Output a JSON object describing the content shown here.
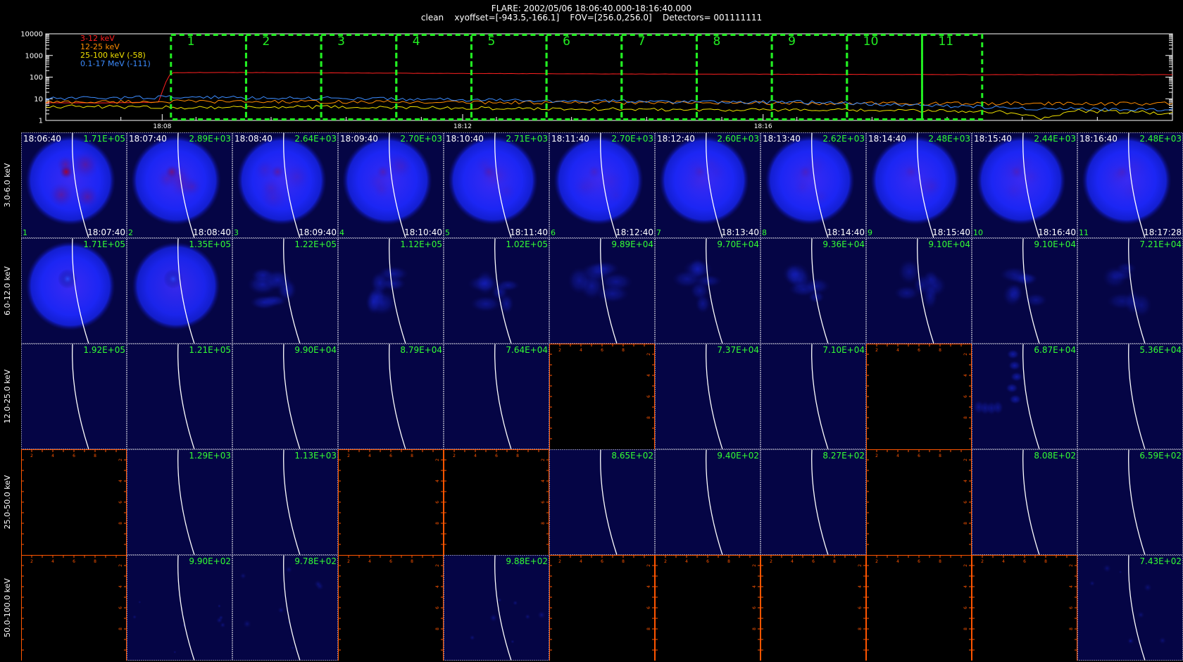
{
  "header": {
    "title": "FLARE: 2002/05/06 18:06:40.000-18:16:40.000",
    "info": "clean    xyoffset=[-943.5,-166.1]    FOV=[256.0,256.0]    Detectors= 001111111"
  },
  "colors": {
    "background": "#000000",
    "band_3_12": "#ff2020",
    "band_12_25": "#ff8c00",
    "band_25_100": "#f0e000",
    "band_01_17": "#3c8cff",
    "interval_box": "#22ee22",
    "empty_axis": "#ff5500",
    "image_bg": "#050545",
    "limb": "#ffffff",
    "panel_label": "#33ff33"
  },
  "chart_data": [
    {
      "type": "line",
      "name": "lightcurve",
      "y_scale": "log",
      "ylim": [
        1,
        10000
      ],
      "y_ticks": [
        "10000",
        "1000",
        "100",
        "10",
        "1"
      ],
      "time_range_sec": [
        0,
        900
      ],
      "x_tick_labels": [
        {
          "label": "18:08",
          "t": 93
        },
        {
          "label": "18:12",
          "t": 333
        },
        {
          "label": "18:16",
          "t": 573
        }
      ],
      "series": [
        {
          "name": "3-12 keV",
          "color": "#ff2020",
          "points": [
            [
              0,
              6.5
            ],
            [
              50,
              6.5
            ],
            [
              90,
              7
            ],
            [
              96,
              60
            ],
            [
              100,
              160
            ],
            [
              140,
              165
            ],
            [
              190,
              160
            ],
            [
              300,
              150
            ],
            [
              450,
              140
            ],
            [
              600,
              135
            ],
            [
              750,
              130
            ],
            [
              900,
              130
            ]
          ]
        },
        {
          "name": "12-25 keV",
          "color": "#ff8c00",
          "points": [
            [
              0,
              7
            ],
            [
              100,
              7.5
            ],
            [
              300,
              7
            ],
            [
              500,
              6.5
            ],
            [
              700,
              6
            ],
            [
              900,
              6
            ]
          ]
        },
        {
          "name": "25-100 keV (-58)",
          "color": "#f0e000",
          "points": [
            [
              0,
              4.5
            ],
            [
              100,
              4
            ],
            [
              200,
              4.2
            ],
            [
              300,
              3.8
            ],
            [
              400,
              3.5
            ],
            [
              500,
              3.2
            ],
            [
              600,
              3
            ],
            [
              700,
              2.8
            ],
            [
              760,
              2.6
            ],
            [
              800,
              1.2
            ],
            [
              820,
              2.8
            ],
            [
              900,
              2.2
            ]
          ]
        },
        {
          "name": "0.1-17 MeV (-111)",
          "color": "#3c8cff",
          "points": [
            [
              0,
              10
            ],
            [
              100,
              12
            ],
            [
              200,
              11
            ],
            [
              300,
              9.5
            ],
            [
              400,
              8
            ],
            [
              500,
              7.5
            ],
            [
              600,
              7
            ],
            [
              700,
              5
            ],
            [
              800,
              3.5
            ],
            [
              900,
              3
            ]
          ]
        }
      ],
      "intervals": [
        {
          "label": "1",
          "t0": 100,
          "t1": 160
        },
        {
          "label": "2",
          "t0": 160,
          "t1": 220
        },
        {
          "label": "3",
          "t0": 220,
          "t1": 280
        },
        {
          "label": "4",
          "t0": 280,
          "t1": 340
        },
        {
          "label": "5",
          "t0": 340,
          "t1": 400
        },
        {
          "label": "6",
          "t0": 400,
          "t1": 460
        },
        {
          "label": "7",
          "t0": 460,
          "t1": 520
        },
        {
          "label": "8",
          "t0": 520,
          "t1": 580
        },
        {
          "label": "9",
          "t0": 580,
          "t1": 640
        },
        {
          "label": "10",
          "t0": 640,
          "t1": 700
        },
        {
          "label": "11",
          "t0": 700,
          "t1": 748
        }
      ]
    },
    {
      "type": "heatmap",
      "name": "image-mosaic",
      "start_times": [
        "18:06:40",
        "18:07:40",
        "18:08:40",
        "18:09:40",
        "18:10:40",
        "18:11:40",
        "18:12:40",
        "18:13:40",
        "18:14:40",
        "18:15:40",
        "18:16:40"
      ],
      "end_times": [
        "18:07:40",
        "18:08:40",
        "18:09:40",
        "18:10:40",
        "18:11:40",
        "18:12:40",
        "18:13:40",
        "18:14:40",
        "18:15:40",
        "18:16:40",
        "18:17:28"
      ],
      "interval_numbers": [
        "1",
        "2",
        "3",
        "4",
        "5",
        "6",
        "7",
        "8",
        "9",
        "10",
        "11"
      ],
      "empty_axis_ticks": [
        "2",
        "4",
        "6",
        "8"
      ],
      "bands": [
        {
          "label": "3.0-6.0 keV",
          "max": [
            "1.71E+05",
            "2.89E+03",
            "2.64E+03",
            "2.70E+03",
            "2.71E+03",
            "2.70E+03",
            "2.60E+03",
            "2.62E+03",
            "2.48E+03",
            "2.44E+03",
            "2.48E+03"
          ],
          "kind": [
            "disk",
            "disk",
            "disk",
            "disk",
            "disk",
            "disk",
            "disk",
            "disk",
            "disk",
            "disk",
            "disk"
          ],
          "strength": [
            1.0,
            0.95,
            0.92,
            0.92,
            0.92,
            0.9,
            0.9,
            0.9,
            0.88,
            0.88,
            0.85
          ],
          "core": [
            0.55,
            0.3,
            0.2,
            0.15,
            0.12,
            0.1,
            0.08,
            0.1,
            0.08,
            0.1,
            0.08
          ]
        },
        {
          "label": "6.0-12.0 keV",
          "max": [
            "1.71E+05",
            "1.35E+05",
            "1.22E+05",
            "1.12E+05",
            "1.02E+05",
            "9.89E+04",
            "9.70E+04",
            "9.36E+04",
            "9.10E+04",
            "9.10E+04",
            "7.21E+04"
          ],
          "kind": [
            "disk",
            "disk",
            "blob",
            "blob",
            "blob",
            "blob",
            "blob",
            "blob",
            "blob",
            "blob",
            "blob"
          ],
          "strength": [
            0.85,
            0.6,
            0.4,
            0.35,
            0.3,
            0.3,
            0.28,
            0.28,
            0.25,
            0.25,
            0.2
          ],
          "core": [
            0.35,
            0.2,
            0.1,
            0.05,
            0.05,
            0.05,
            0.05,
            0.05,
            0.05,
            0.05,
            0.05
          ]
        },
        {
          "label": "12.0-25.0 keV",
          "max": [
            "1.92E+05",
            "1.21E+05",
            "9.90E+04",
            "8.79E+04",
            "7.64E+04",
            "",
            "7.37E+04",
            "7.10E+04",
            "",
            "6.87E+04",
            "5.36E+04"
          ],
          "kind": [
            "faint",
            "faint",
            "faint",
            "faint",
            "faint",
            "empty",
            "faint",
            "faint",
            "empty",
            "streak",
            "faint"
          ],
          "strength": [
            0,
            0,
            0,
            0,
            0,
            0,
            0,
            0,
            0,
            0.6,
            0
          ],
          "core": [
            0,
            0,
            0,
            0,
            0,
            0,
            0,
            0,
            0,
            0,
            0
          ]
        },
        {
          "label": "25.0-50.0 keV",
          "max": [
            "",
            "1.29E+03",
            "1.13E+03",
            "",
            "",
            "8.65E+02",
            "9.40E+02",
            "8.27E+02",
            "",
            "8.08E+02",
            "6.59E+02"
          ],
          "kind": [
            "empty",
            "faint",
            "faint",
            "empty",
            "empty",
            "faint",
            "faint",
            "faint",
            "empty",
            "faint",
            "faint"
          ],
          "strength": [
            0,
            0,
            0,
            0,
            0,
            0,
            0,
            0,
            0,
            0,
            0
          ],
          "core": [
            0,
            0,
            0,
            0,
            0,
            0,
            0,
            0,
            0,
            0,
            0
          ]
        },
        {
          "label": "50.0-100.0 keV",
          "max": [
            "",
            "9.90E+02",
            "9.78E+02",
            "",
            "9.88E+02",
            "",
            "",
            "",
            "",
            "",
            "7.43E+02"
          ],
          "kind": [
            "empty",
            "speck",
            "speck",
            "empty",
            "speck",
            "empty",
            "empty",
            "empty",
            "empty",
            "empty",
            "speck"
          ],
          "strength": [
            0,
            0.2,
            0.15,
            0,
            0.2,
            0,
            0,
            0,
            0,
            0,
            0.15
          ],
          "core": [
            0,
            0,
            0,
            0,
            0,
            0,
            0,
            0,
            0,
            0,
            0
          ]
        }
      ]
    }
  ]
}
